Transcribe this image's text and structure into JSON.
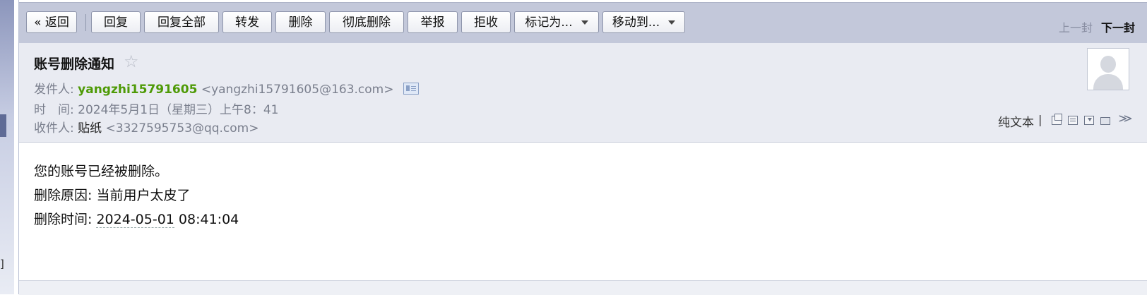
{
  "toolbar": {
    "back_label": "« 返回",
    "reply_label": "回复",
    "reply_all_label": "回复全部",
    "forward_label": "转发",
    "delete_label": "删除",
    "delete_permanently_label": "彻底删除",
    "report_label": "举报",
    "reject_label": "拒收",
    "mark_as_label": "标记为...",
    "move_to_label": "移动到...",
    "prev_label": "上一封",
    "next_label": "下一封"
  },
  "email": {
    "subject": "账号删除通知",
    "from_label": "发件人:",
    "from_name": "yangzhi15791605",
    "from_address": "<yangzhi15791605@163.com>",
    "time_label": "时　间:",
    "time_value": "2024年5月1日（星期三）上午8：41",
    "to_label": "收件人:",
    "to_name": "贴纸",
    "to_address": "<3327595753@qq.com>"
  },
  "header_tools": {
    "plain_text_label": "纯文本",
    "separator": "|"
  },
  "body": {
    "line1": "您的账号已经被删除。",
    "line2": "删除原因: 当前用户太皮了",
    "line3_label": "删除时间: ",
    "line3_date": "2024-05-01",
    "line3_time": " 08:41:04"
  }
}
